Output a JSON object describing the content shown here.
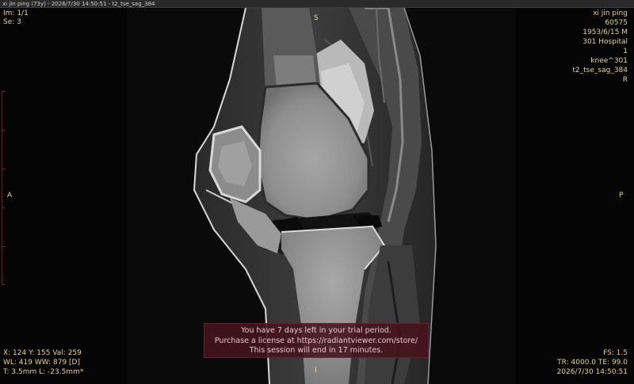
{
  "window": {
    "title": "xi jin ping (73y) - 2026/7/30 14:50:51 - t2_tse_sag_384"
  },
  "overlay": {
    "top_left": {
      "image_index": "Im: 1/1",
      "series": "Se: 3"
    },
    "top_center": "S",
    "top_right": {
      "patient_name": "xi jin ping",
      "patient_id": "60575",
      "birth_sex": "1953/6/15 M",
      "institution": "301 Hospital",
      "study_number": "1",
      "study_desc": "knee^301",
      "series_desc": "t2_tse_sag_384",
      "orientation": "R"
    },
    "left_center": "A",
    "right_center": "P",
    "bottom_center": "I",
    "bottom_left": {
      "cursor": "X: 124 Y: 155 Val: 259",
      "window_level": "WL: 419 WW: 879 [D]",
      "thickness": "T: 3.5mm L: -23.5mm*"
    },
    "bottom_right": {
      "field_strength": "FS: 1.5",
      "tr_te": "TR: 4000.0 TE: 99.0",
      "datetime": "2026/7/30 14:50:51"
    }
  },
  "trial": {
    "line1": "You have 7 days left in your trial period.",
    "line2": "Purchase a license at https://radiantviewer.com/store/",
    "line3": "This session will end in 17 minutes."
  },
  "colors": {
    "overlay_text": "#e8d690",
    "trial_bg": "#46121e",
    "ruler": "#7a1a1a"
  }
}
